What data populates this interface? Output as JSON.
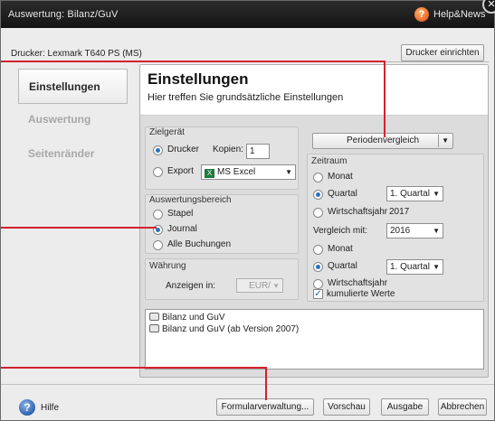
{
  "window": {
    "title": "Auswertung: Bilanz/GuV",
    "help_news": "Help&News",
    "close_glyph": "✕"
  },
  "printer": {
    "label": "Drucker:  Lexmark T640 PS (MS)",
    "setup_button": "Drucker einrichten"
  },
  "sidebar": {
    "items": [
      {
        "label": "Einstellungen",
        "active": true
      },
      {
        "label": "Auswertung",
        "active": false
      },
      {
        "label": "Seitenränder",
        "active": false
      }
    ]
  },
  "header": {
    "title": "Einstellungen",
    "subtitle": "Hier treffen Sie grundsätzliche Einstellungen"
  },
  "zielgeraet": {
    "label": "Zielgerät",
    "drucker": "Drucker",
    "kopien_label": "Kopien:",
    "kopien_value": "1",
    "export": "Export",
    "export_format": "MS Excel",
    "excel_glyph": "X"
  },
  "auswertungsbereich": {
    "label": "Auswertungsbereich",
    "options": [
      "Stapel",
      "Journal",
      "Alle Buchungen"
    ],
    "selected": "Journal"
  },
  "waehrung": {
    "label": "Währung",
    "anzeigen_label": "Anzeigen in:",
    "value": "EUR/"
  },
  "periodenvergleich": {
    "label": "Periodenvergleich"
  },
  "zeitraum": {
    "label": "Zeitraum",
    "monat": "Monat",
    "quartal": "Quartal",
    "quartal_value": "1. Quartal",
    "wirtschaftsjahr": "Wirtschaftsjahr",
    "wirtschaftsjahr_value": "2017",
    "vergleich_label": "Vergleich mit:",
    "vergleich_value": "2016",
    "monat2": "Monat",
    "quartal2": "Quartal",
    "quartal2_value": "1. Quartal",
    "wirtschaftsjahr2": "Wirtschaftsjahr",
    "kumulierte": "kumulierte Werte"
  },
  "list": {
    "items": [
      "Bilanz und GuV",
      "Bilanz und GuV (ab Version 2007)"
    ]
  },
  "footer": {
    "help_glyph": "?",
    "help_label": "Hilfe",
    "formularverwaltung": "Formularverwaltung...",
    "vorschau": "Vorschau",
    "ausgabe": "Ausgabe",
    "abbrechen": "Abbrechen"
  },
  "icons": {
    "dropdown_arrow": "▼",
    "check_mark": "✓"
  },
  "colors": {
    "callout_red": "#d3212e",
    "selection_blue": "#2a74c4"
  }
}
